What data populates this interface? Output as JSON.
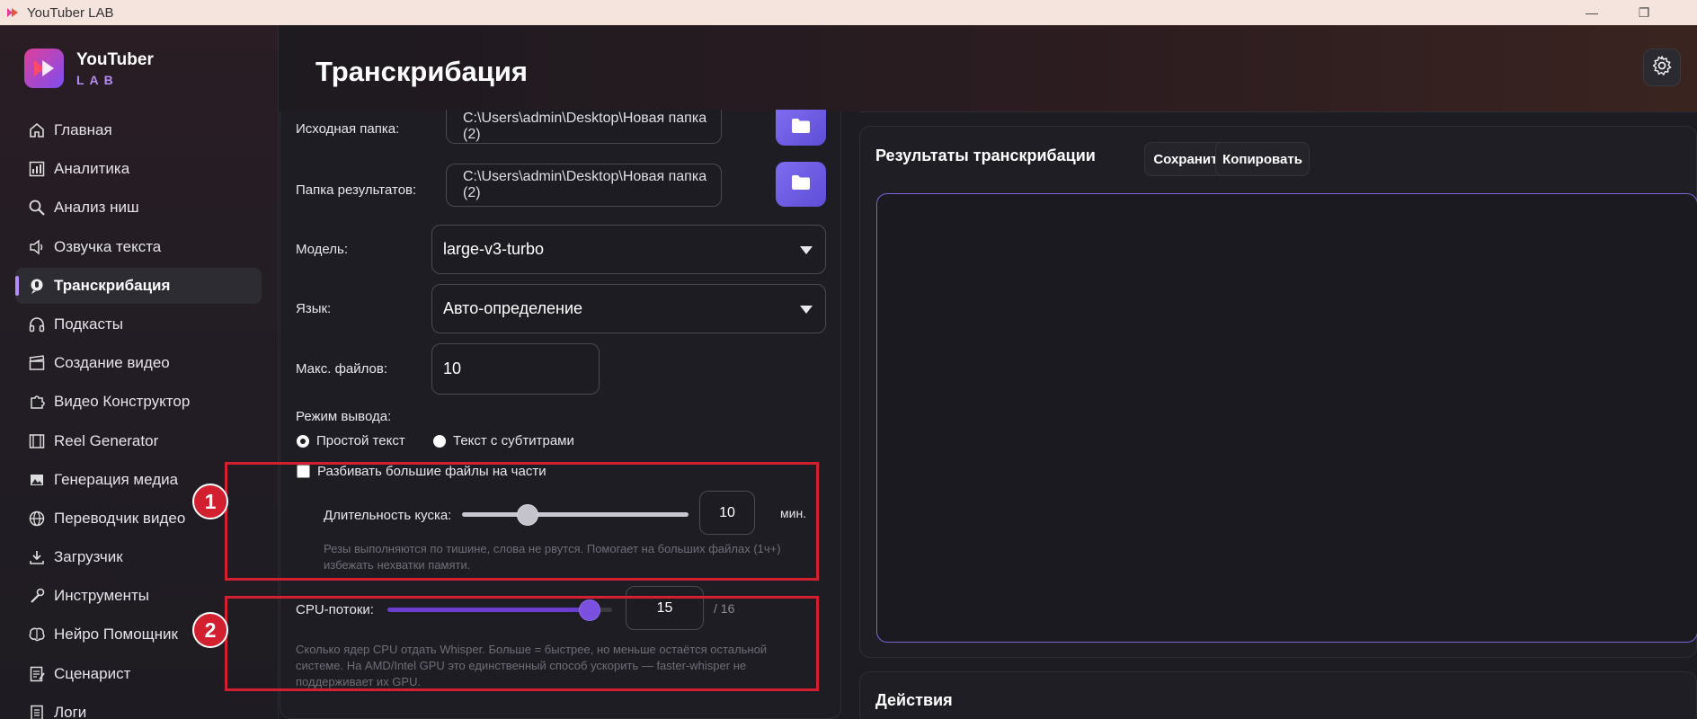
{
  "window": {
    "title": "YouTuber LAB",
    "minimize_glyph": "—",
    "restore_glyph": "❐"
  },
  "brand": {
    "name": "YouTuber",
    "sub": "LAB"
  },
  "sidebar": {
    "items": [
      {
        "label": "Главная",
        "icon": "home-icon"
      },
      {
        "label": "Аналитика",
        "icon": "chart-icon"
      },
      {
        "label": "Анализ ниш",
        "icon": "search-icon"
      },
      {
        "label": "Озвучка текста",
        "icon": "speaker-icon"
      },
      {
        "label": "Транскрибация",
        "icon": "transcribe-icon",
        "active": true
      },
      {
        "label": "Подкасты",
        "icon": "headphones-icon"
      },
      {
        "label": "Создание видео",
        "icon": "clapperboard-icon"
      },
      {
        "label": "Видео Конструктор",
        "icon": "puzzle-icon"
      },
      {
        "label": "Reel Generator",
        "icon": "film-icon"
      },
      {
        "label": "Генерация медиа",
        "icon": "image-icon"
      },
      {
        "label": "Переводчик видео",
        "icon": "globe-icon"
      },
      {
        "label": "Загрузчик",
        "icon": "download-icon"
      },
      {
        "label": "Инструменты",
        "icon": "wrench-icon"
      },
      {
        "label": "Нейро Помощник",
        "icon": "brain-icon"
      },
      {
        "label": "Сценарист",
        "icon": "script-icon"
      },
      {
        "label": "Логи",
        "icon": "log-icon"
      }
    ]
  },
  "header": {
    "title": "Транскрибация",
    "settings_icon": "gear-icon"
  },
  "settings": {
    "source_folder": {
      "label": "Исходная папка:",
      "value": "C:\\Users\\admin\\Desktop\\Новая папка (2)"
    },
    "results_folder": {
      "label": "Папка результатов:",
      "value": "C:\\Users\\admin\\Desktop\\Новая папка (2)"
    },
    "model": {
      "label": "Модель:",
      "value": "large-v3-turbo"
    },
    "language": {
      "label": "Язык:",
      "value": "Авто-определение"
    },
    "max_files": {
      "label": "Макс. файлов:",
      "value": "10"
    },
    "output_mode": {
      "label": "Режим вывода:",
      "options": [
        {
          "label": "Простой текст",
          "selected": true
        },
        {
          "label": "Текст с субтитрами",
          "selected": false
        }
      ]
    },
    "split": {
      "checkbox_label": "Разбивать большие файлы на части",
      "checked": false,
      "chunk_label": "Длительность куска:",
      "chunk_value": "10",
      "chunk_unit": "мин.",
      "chunk_slider_fraction": 0.29,
      "hint_line1": "Резы выполняются по тишине, слова не рвутся. Помогает на больших файлах (1ч+)",
      "hint_line2": "избежать нехватки памяти."
    },
    "cpu": {
      "label": "CPU-потоки:",
      "value": "15",
      "max": "/ 16",
      "slider_fraction": 0.9,
      "hint_line1": "Сколько ядер CPU отдать Whisper. Больше = быстрее, но меньше остаётся остальной",
      "hint_line2": "системе. На AMD/Intel GPU это единственный способ ускорить — faster-whisper не",
      "hint_line3": "поддерживает их GPU."
    }
  },
  "annotations": {
    "first": "1",
    "second": "2"
  },
  "results": {
    "title": "Результаты транскрибации",
    "save_label": "Сохранить",
    "copy_label": "Копировать",
    "text": ""
  },
  "actions": {
    "title": "Действия"
  },
  "colors": {
    "accent": "#7e6cf0",
    "annotation": "#d22030",
    "slider_fill": "#6a3fd0"
  }
}
